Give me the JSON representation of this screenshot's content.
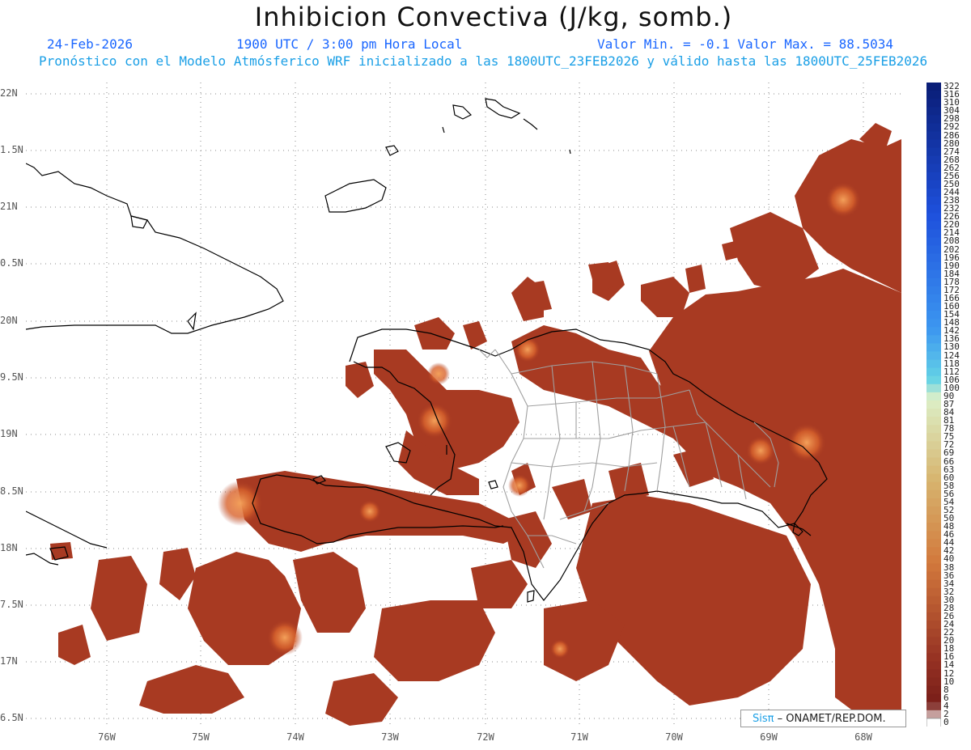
{
  "title": "Inhibicion Convectiva (J/kg, somb.)",
  "header": {
    "date": "24-Feb-2026",
    "time": "1900 UTC / 3:00 pm Hora Local",
    "minmax": "Valor Min. = -0.1  Valor Max. = 88.5034",
    "subtitle": "Pronóstico con el Modelo Atmósferico WRF inicializado a las 1800UTC_23FEB2026 y válido hasta las  1800UTC_25FEB2026"
  },
  "map": {
    "lat_ticks": [
      "22N",
      "1.5N",
      "21N",
      "0.5N",
      "20N",
      "9.5N",
      "19N",
      "8.5N",
      "18N",
      "7.5N",
      "17N",
      "6.5N"
    ],
    "lon_ticks": [
      "76W",
      "75W",
      "74W",
      "73W",
      "72W",
      "71W",
      "70W",
      "69W",
      "68W"
    ],
    "shade_color": "#a83a22",
    "highlight_color": "#e8782e",
    "coastline_color": "#000000",
    "border_color": "#a0a0a0"
  },
  "colorbar": {
    "labels": [
      "322",
      "316",
      "310",
      "304",
      "298",
      "292",
      "286",
      "280",
      "274",
      "268",
      "262",
      "256",
      "250",
      "244",
      "238",
      "232",
      "226",
      "220",
      "214",
      "208",
      "202",
      "196",
      "190",
      "184",
      "178",
      "172",
      "166",
      "160",
      "154",
      "148",
      "142",
      "136",
      "130",
      "124",
      "118",
      "112",
      "106",
      "100",
      "90",
      "87",
      "84",
      "81",
      "78",
      "75",
      "72",
      "69",
      "66",
      "63",
      "60",
      "58",
      "56",
      "54",
      "52",
      "50",
      "48",
      "46",
      "44",
      "42",
      "40",
      "38",
      "36",
      "34",
      "32",
      "30",
      "28",
      "26",
      "24",
      "22",
      "20",
      "18",
      "16",
      "14",
      "12",
      "10",
      "8",
      "6",
      "4",
      "2",
      "0"
    ]
  },
  "credit": {
    "brand": "Sisπ",
    "text": " – ONAMET/REP.DOM."
  }
}
